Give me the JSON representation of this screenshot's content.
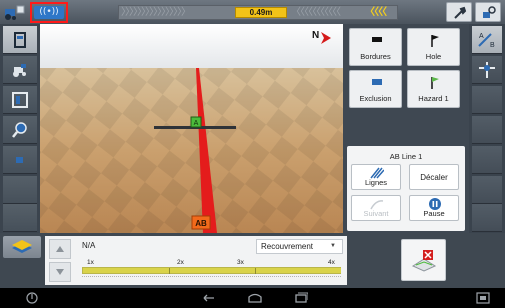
{
  "topbar": {
    "gps_label": "((•))",
    "lightbar": {
      "chevrons_left": "〉〉〉〉〉〉〉〉〉〉〉〉〉〉〉〉",
      "distance": "0.49m",
      "chevrons_right": "〈〈〈〈〈〈〈〈〈〈〈",
      "chevrons_active": "〈〈〈〈"
    }
  },
  "view": {
    "compass_label": "N",
    "guidance_marker_label": "A",
    "ab_marker_label": "AB"
  },
  "right_panel": {
    "buttons": [
      {
        "label": "Bordures",
        "icon": "flag-boundary-icon"
      },
      {
        "label": "Hole",
        "icon": "flag-hole-icon"
      },
      {
        "label": "Exclusion",
        "icon": "flag-exclusion-icon"
      },
      {
        "label": "Hazard 1",
        "icon": "flag-hazard-icon"
      }
    ],
    "ab_title": "AB Line 1",
    "lignes_label": "Lignes",
    "decaler_label": "Décaler",
    "suivant_label": "Suivant",
    "pause_label": "Pause"
  },
  "bottom": {
    "na_label": "N/A",
    "dropdown_value": "Recouvrement",
    "scale_labels": [
      "1x",
      "2x",
      "3x",
      "4x"
    ]
  },
  "colors": {
    "accent_yellow": "#f2c318",
    "gps_highlight": "#ff1a1a",
    "gps_blue": "#2e77c8",
    "guidance_red": "#e41c1c",
    "ab_marker": "#f26a1b",
    "marker_green": "#4cbb3b",
    "panel_grey": "#3f4852"
  }
}
